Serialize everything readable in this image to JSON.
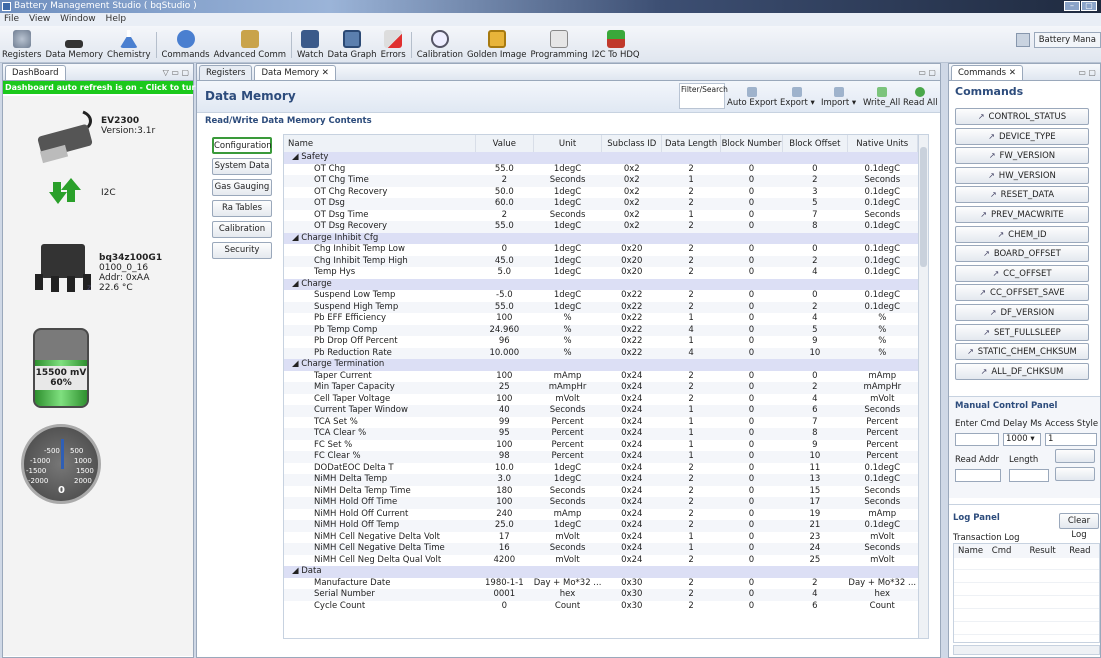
{
  "app": {
    "title": "Battery Management Studio ( bqStudio )",
    "menu": [
      "File",
      "View",
      "Window",
      "Help"
    ],
    "win_buttons": [
      "–",
      "▢"
    ]
  },
  "toolbar": {
    "buttons": [
      "Registers",
      "Data Memory",
      "Chemistry",
      "Commands",
      "Advanced Comm",
      "Watch",
      "Data Graph",
      "Errors",
      "Calibration",
      "Golden Image",
      "Programming",
      "I2C To HDQ"
    ],
    "perspective": "Battery Mana"
  },
  "dashboard": {
    "tab": "DashBoard",
    "refresh_banner": "Dashboard auto refresh is on - Click to turn off",
    "adapter_name": "EV2300",
    "adapter_version": "Version:3.1r",
    "bus": "I2C",
    "device_name": "bq34z100G1",
    "device_fw": "0100_0_16",
    "device_addr": "Addr: 0xAA",
    "device_temp": "22.6 °C",
    "battery_mv": "15500 mV",
    "battery_pct": "60%",
    "gauge_ticks": [
      "-500",
      "500",
      "-1000",
      "1000",
      "-1500",
      "1500",
      "-2000",
      "2000"
    ],
    "gauge_value": "0",
    "battery_level": 0.6
  },
  "main": {
    "tabs": [
      "Registers",
      "Data Memory"
    ],
    "title": "Data Memory",
    "filter_label": "Filter/Search",
    "header_buttons": [
      "Auto Export",
      "Export",
      "Import",
      "Write_All",
      "Read All"
    ],
    "section_label": "Read/Write Data Memory Contents",
    "categories": [
      "Configuration",
      "System Data",
      "Gas Gauging",
      "Ra Tables",
      "Calibration",
      "Security"
    ],
    "selected_category": "Configuration",
    "columns": [
      "Name",
      "Value",
      "Unit",
      "Subclass ID",
      "Data Length",
      "Block Number",
      "Block Offset",
      "Native Units"
    ],
    "rows": [
      {
        "section": "Safety"
      },
      [
        "OT Chg",
        "55.0",
        "1degC",
        "0x2",
        "2",
        "0",
        "0",
        "0.1degC"
      ],
      [
        "OT Chg Time",
        "2",
        "Seconds",
        "0x2",
        "1",
        "0",
        "2",
        "Seconds"
      ],
      [
        "OT Chg Recovery",
        "50.0",
        "1degC",
        "0x2",
        "2",
        "0",
        "3",
        "0.1degC"
      ],
      [
        "OT Dsg",
        "60.0",
        "1degC",
        "0x2",
        "2",
        "0",
        "5",
        "0.1degC"
      ],
      [
        "OT Dsg Time",
        "2",
        "Seconds",
        "0x2",
        "1",
        "0",
        "7",
        "Seconds"
      ],
      [
        "OT Dsg Recovery",
        "55.0",
        "1degC",
        "0x2",
        "2",
        "0",
        "8",
        "0.1degC"
      ],
      {
        "section": "Charge Inhibit Cfg"
      },
      [
        "Chg Inhibit Temp Low",
        "0",
        "1degC",
        "0x20",
        "2",
        "0",
        "0",
        "0.1degC"
      ],
      [
        "Chg Inhibit Temp High",
        "45.0",
        "1degC",
        "0x20",
        "2",
        "0",
        "2",
        "0.1degC"
      ],
      [
        "Temp Hys",
        "5.0",
        "1degC",
        "0x20",
        "2",
        "0",
        "4",
        "0.1degC"
      ],
      {
        "section": "Charge"
      },
      [
        "Suspend Low Temp",
        "-5.0",
        "1degC",
        "0x22",
        "2",
        "0",
        "0",
        "0.1degC"
      ],
      [
        "Suspend High Temp",
        "55.0",
        "1degC",
        "0x22",
        "2",
        "0",
        "2",
        "0.1degC"
      ],
      [
        "Pb EFF Efficiency",
        "100",
        "%",
        "0x22",
        "1",
        "0",
        "4",
        "%"
      ],
      [
        "Pb Temp Comp",
        "24.960",
        "%",
        "0x22",
        "4",
        "0",
        "5",
        "%"
      ],
      [
        "Pb Drop Off Percent",
        "96",
        "%",
        "0x22",
        "1",
        "0",
        "9",
        "%"
      ],
      [
        "Pb Reduction Rate",
        "10.000",
        "%",
        "0x22",
        "4",
        "0",
        "10",
        "%"
      ],
      {
        "section": "Charge Termination"
      },
      [
        "Taper Current",
        "100",
        "mAmp",
        "0x24",
        "2",
        "0",
        "0",
        "mAmp"
      ],
      [
        "Min Taper Capacity",
        "25",
        "mAmpHr",
        "0x24",
        "2",
        "0",
        "2",
        "mAmpHr"
      ],
      [
        "Cell Taper Voltage",
        "100",
        "mVolt",
        "0x24",
        "2",
        "0",
        "4",
        "mVolt"
      ],
      [
        "Current Taper Window",
        "40",
        "Seconds",
        "0x24",
        "1",
        "0",
        "6",
        "Seconds"
      ],
      [
        "TCA Set %",
        "99",
        "Percent",
        "0x24",
        "1",
        "0",
        "7",
        "Percent"
      ],
      [
        "TCA Clear %",
        "95",
        "Percent",
        "0x24",
        "1",
        "0",
        "8",
        "Percent"
      ],
      [
        "FC Set %",
        "100",
        "Percent",
        "0x24",
        "1",
        "0",
        "9",
        "Percent"
      ],
      [
        "FC Clear %",
        "98",
        "Percent",
        "0x24",
        "1",
        "0",
        "10",
        "Percent"
      ],
      [
        "DODatEOC Delta T",
        "10.0",
        "1degC",
        "0x24",
        "2",
        "0",
        "11",
        "0.1degC"
      ],
      [
        "NiMH Delta Temp",
        "3.0",
        "1degC",
        "0x24",
        "2",
        "0",
        "13",
        "0.1degC"
      ],
      [
        "NiMH Delta Temp Time",
        "180",
        "Seconds",
        "0x24",
        "2",
        "0",
        "15",
        "Seconds"
      ],
      [
        "NiMH Hold Off  Time",
        "100",
        "Seconds",
        "0x24",
        "2",
        "0",
        "17",
        "Seconds"
      ],
      [
        "NiMH Hold Off Current",
        "240",
        "mAmp",
        "0x24",
        "2",
        "0",
        "19",
        "mAmp"
      ],
      [
        "NiMH Hold Off Temp",
        "25.0",
        "1degC",
        "0x24",
        "2",
        "0",
        "21",
        "0.1degC"
      ],
      [
        "NiMH Cell Negative Delta Volt",
        "17",
        "mVolt",
        "0x24",
        "1",
        "0",
        "23",
        "mVolt"
      ],
      [
        "NiMH Cell Negative Delta Time",
        "16",
        "Seconds",
        "0x24",
        "1",
        "0",
        "24",
        "Seconds"
      ],
      [
        "NiMH Cell Neg Delta Qual Volt",
        "4200",
        "mVolt",
        "0x24",
        "2",
        "0",
        "25",
        "mVolt"
      ],
      {
        "section": "Data"
      },
      [
        "Manufacture Date",
        "1980-1-1",
        "Day + Mo*32 ...",
        "0x30",
        "2",
        "0",
        "2",
        "Day + Mo*32 ..."
      ],
      [
        "Serial Number",
        "0001",
        "hex",
        "0x30",
        "2",
        "0",
        "4",
        "hex"
      ],
      [
        "Cycle Count",
        "0",
        "Count",
        "0x30",
        "2",
        "0",
        "6",
        "Count"
      ]
    ]
  },
  "commands": {
    "tab": "Commands",
    "title": "Commands",
    "items": [
      "CONTROL_STATUS",
      "DEVICE_TYPE",
      "FW_VERSION",
      "HW_VERSION",
      "RESET_DATA",
      "PREV_MACWRITE",
      "CHEM_ID",
      "BOARD_OFFSET",
      "CC_OFFSET",
      "CC_OFFSET_SAVE",
      "DF_VERSION",
      "SET_FULLSLEEP",
      "STATIC_CHEM_CHKSUM",
      "ALL_DF_CHKSUM"
    ],
    "manual_panel": {
      "title": "Manual Control Panel",
      "enter_cmd": "Enter Cmd",
      "delay_ms": "Delay Ms",
      "access_style": "Access Style",
      "delay_value": "1000",
      "access_value": "1",
      "read_addr": "Read Addr",
      "length": "Length"
    },
    "log_panel": {
      "title": "Log Panel",
      "clear": "Clear Log",
      "transaction": "Transaction Log",
      "columns": [
        "Name",
        "Cmd",
        "Result",
        "Read"
      ]
    }
  },
  "colors": {
    "refresh_green": "#1bc91b",
    "header_blue": "#2d4c7c",
    "section_row": "#dcdff5"
  }
}
